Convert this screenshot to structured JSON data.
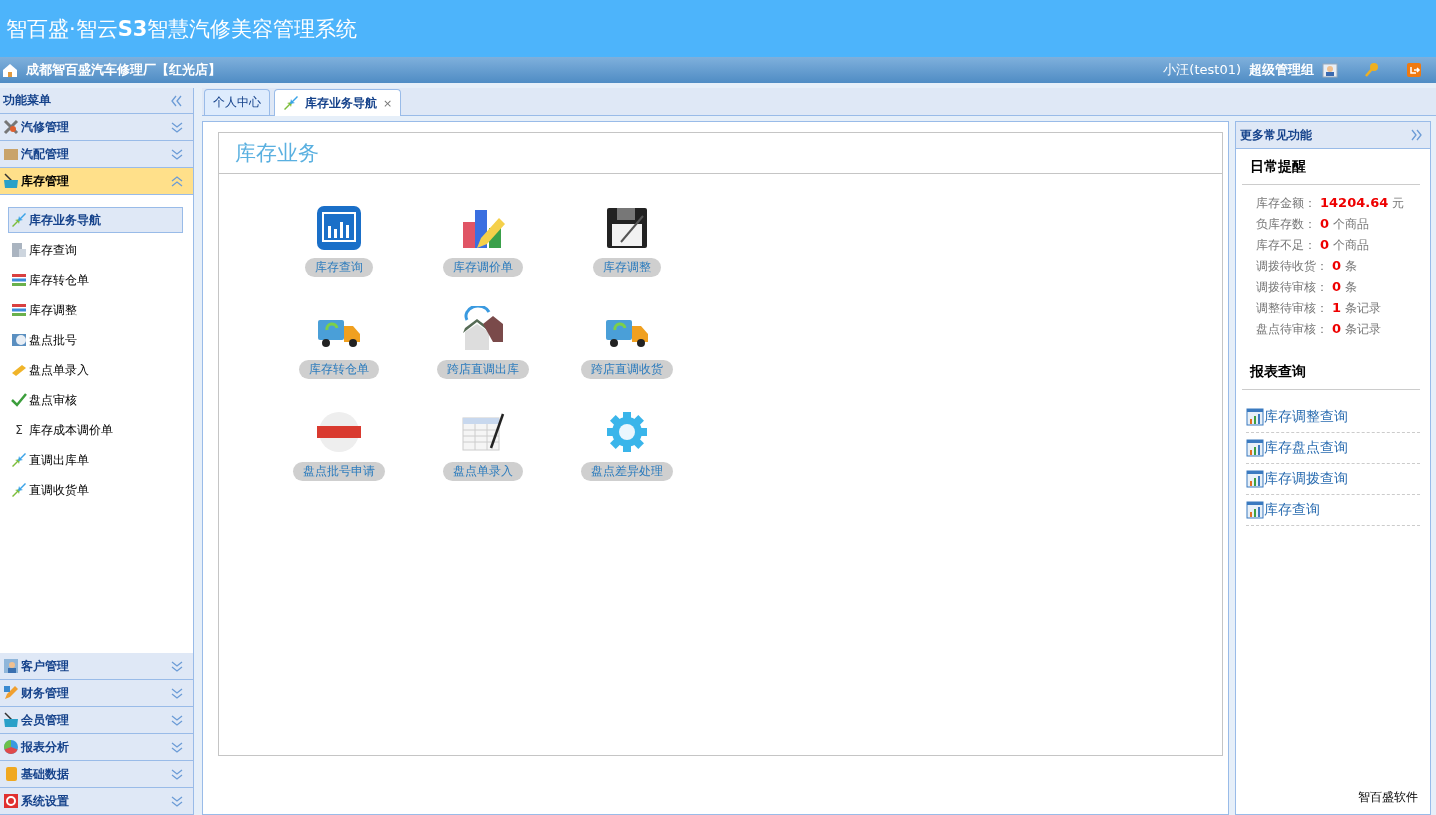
{
  "app_title": "智百盛·智云**S3**智慧汽修美容管理系统",
  "store_bar": {
    "store": "成都智百盛汽车修理厂【红光店】",
    "user": "小汪(test01)",
    "role": "超级管理组"
  },
  "sidebar": {
    "title": "功能菜单",
    "sections": [
      {
        "label": "汽修管理",
        "expanded": false
      },
      {
        "label": "汽配管理",
        "expanded": false
      },
      {
        "label": "库存管理",
        "expanded": true,
        "items": [
          {
            "label": "库存业务导航",
            "selected": true
          },
          {
            "label": "库存查询",
            "selected": false
          },
          {
            "label": "库存转仓单",
            "selected": false
          },
          {
            "label": "库存调整",
            "selected": false
          },
          {
            "label": "盘点批号",
            "selected": false
          },
          {
            "label": "盘点单录入",
            "selected": false
          },
          {
            "label": "盘点审核",
            "selected": false
          },
          {
            "label": "库存成本调价单",
            "selected": false,
            "glyph": "Σ"
          },
          {
            "label": "直调出库单",
            "selected": false
          },
          {
            "label": "直调收货单",
            "selected": false
          }
        ]
      },
      {
        "label": "客户管理",
        "expanded": false
      },
      {
        "label": "财务管理",
        "expanded": false
      },
      {
        "label": "会员管理",
        "expanded": false
      },
      {
        "label": "报表分析",
        "expanded": false
      },
      {
        "label": "基础数据",
        "expanded": false
      },
      {
        "label": "系统设置",
        "expanded": false
      }
    ]
  },
  "tabs": [
    {
      "label": "个人中心",
      "selected": false
    },
    {
      "label": "库存业务导航",
      "selected": true,
      "close": "×"
    }
  ],
  "panel": {
    "title": "库存业务",
    "tiles": [
      {
        "label": "库存查询"
      },
      {
        "label": "库存调价单"
      },
      {
        "label": "库存调整"
      },
      {
        "label": "库存转仓单"
      },
      {
        "label": "跨店直调出库"
      },
      {
        "label": "跨店直调收货"
      },
      {
        "label": "盘点批号申请"
      },
      {
        "label": "盘点单录入"
      },
      {
        "label": "盘点差异处理"
      }
    ]
  },
  "right_panel": {
    "title": "更多常见功能",
    "reminders_title": "日常提醒",
    "reminders": [
      {
        "label": "库存金额：",
        "value": "14204.64",
        "unit": "元"
      },
      {
        "label": "负库存数：",
        "value": "0",
        "unit": "个商品"
      },
      {
        "label": "库存不足：",
        "value": "0",
        "unit": "个商品"
      },
      {
        "label": "调拨待收货：",
        "value": "0",
        "unit": "条"
      },
      {
        "label": "调拨待审核：",
        "value": "0",
        "unit": "条"
      },
      {
        "label": "调整待审核：",
        "value": "1",
        "unit": "条记录"
      },
      {
        "label": "盘点待审核：",
        "value": "0",
        "unit": "条记录"
      }
    ],
    "reports_title": "报表查询",
    "reports": [
      "库存调整查询",
      "库存盘点查询",
      "库存调拨查询",
      "库存查询"
    ],
    "footer": "智百盛软件"
  }
}
